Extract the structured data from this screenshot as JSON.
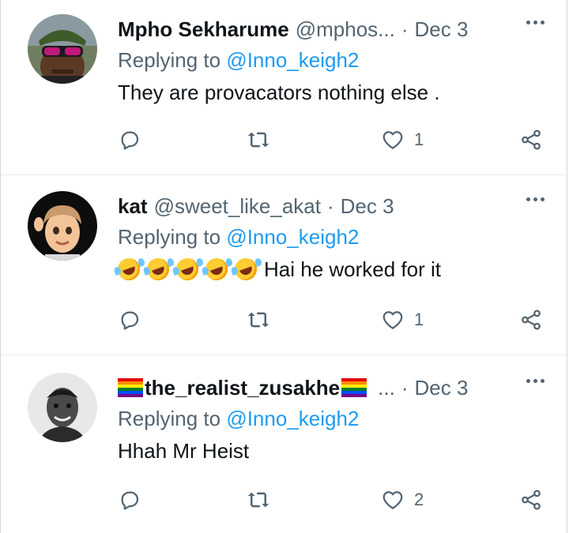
{
  "tweets": [
    {
      "name": "Mpho Sekharume",
      "handle": "@mphos...",
      "date": "Dec 3",
      "replying_prefix": "Replying to ",
      "replying_to": "@Inno_keigh2",
      "text": "They are provacators nothing else .",
      "likes": "1",
      "avatar": "avatar-man-sunglasses"
    },
    {
      "name": "kat",
      "handle": "@sweet_like_akat",
      "date": "Dec 3",
      "replying_prefix": "Replying to ",
      "replying_to": "@Inno_keigh2",
      "text": "Hai he worked for it",
      "emoji_count": 5,
      "likes": "1",
      "avatar": "avatar-memoji"
    },
    {
      "name": "the_realist_zusakhe",
      "handle": "...",
      "date": "Dec 3",
      "replying_prefix": "Replying to ",
      "replying_to": "@Inno_keigh2",
      "text": "Hhah Mr Heist",
      "likes": "2",
      "avatar": "avatar-man-bw"
    }
  ],
  "colors": {
    "link": "#1d9bf0",
    "secondary": "#536471",
    "primary_text": "#0f1419"
  },
  "icons": [
    "reply-icon",
    "retweet-icon",
    "like-icon",
    "share-icon",
    "more-icon",
    "rainbow-flag-icon",
    "rolling-laughing-emoji-icon"
  ]
}
